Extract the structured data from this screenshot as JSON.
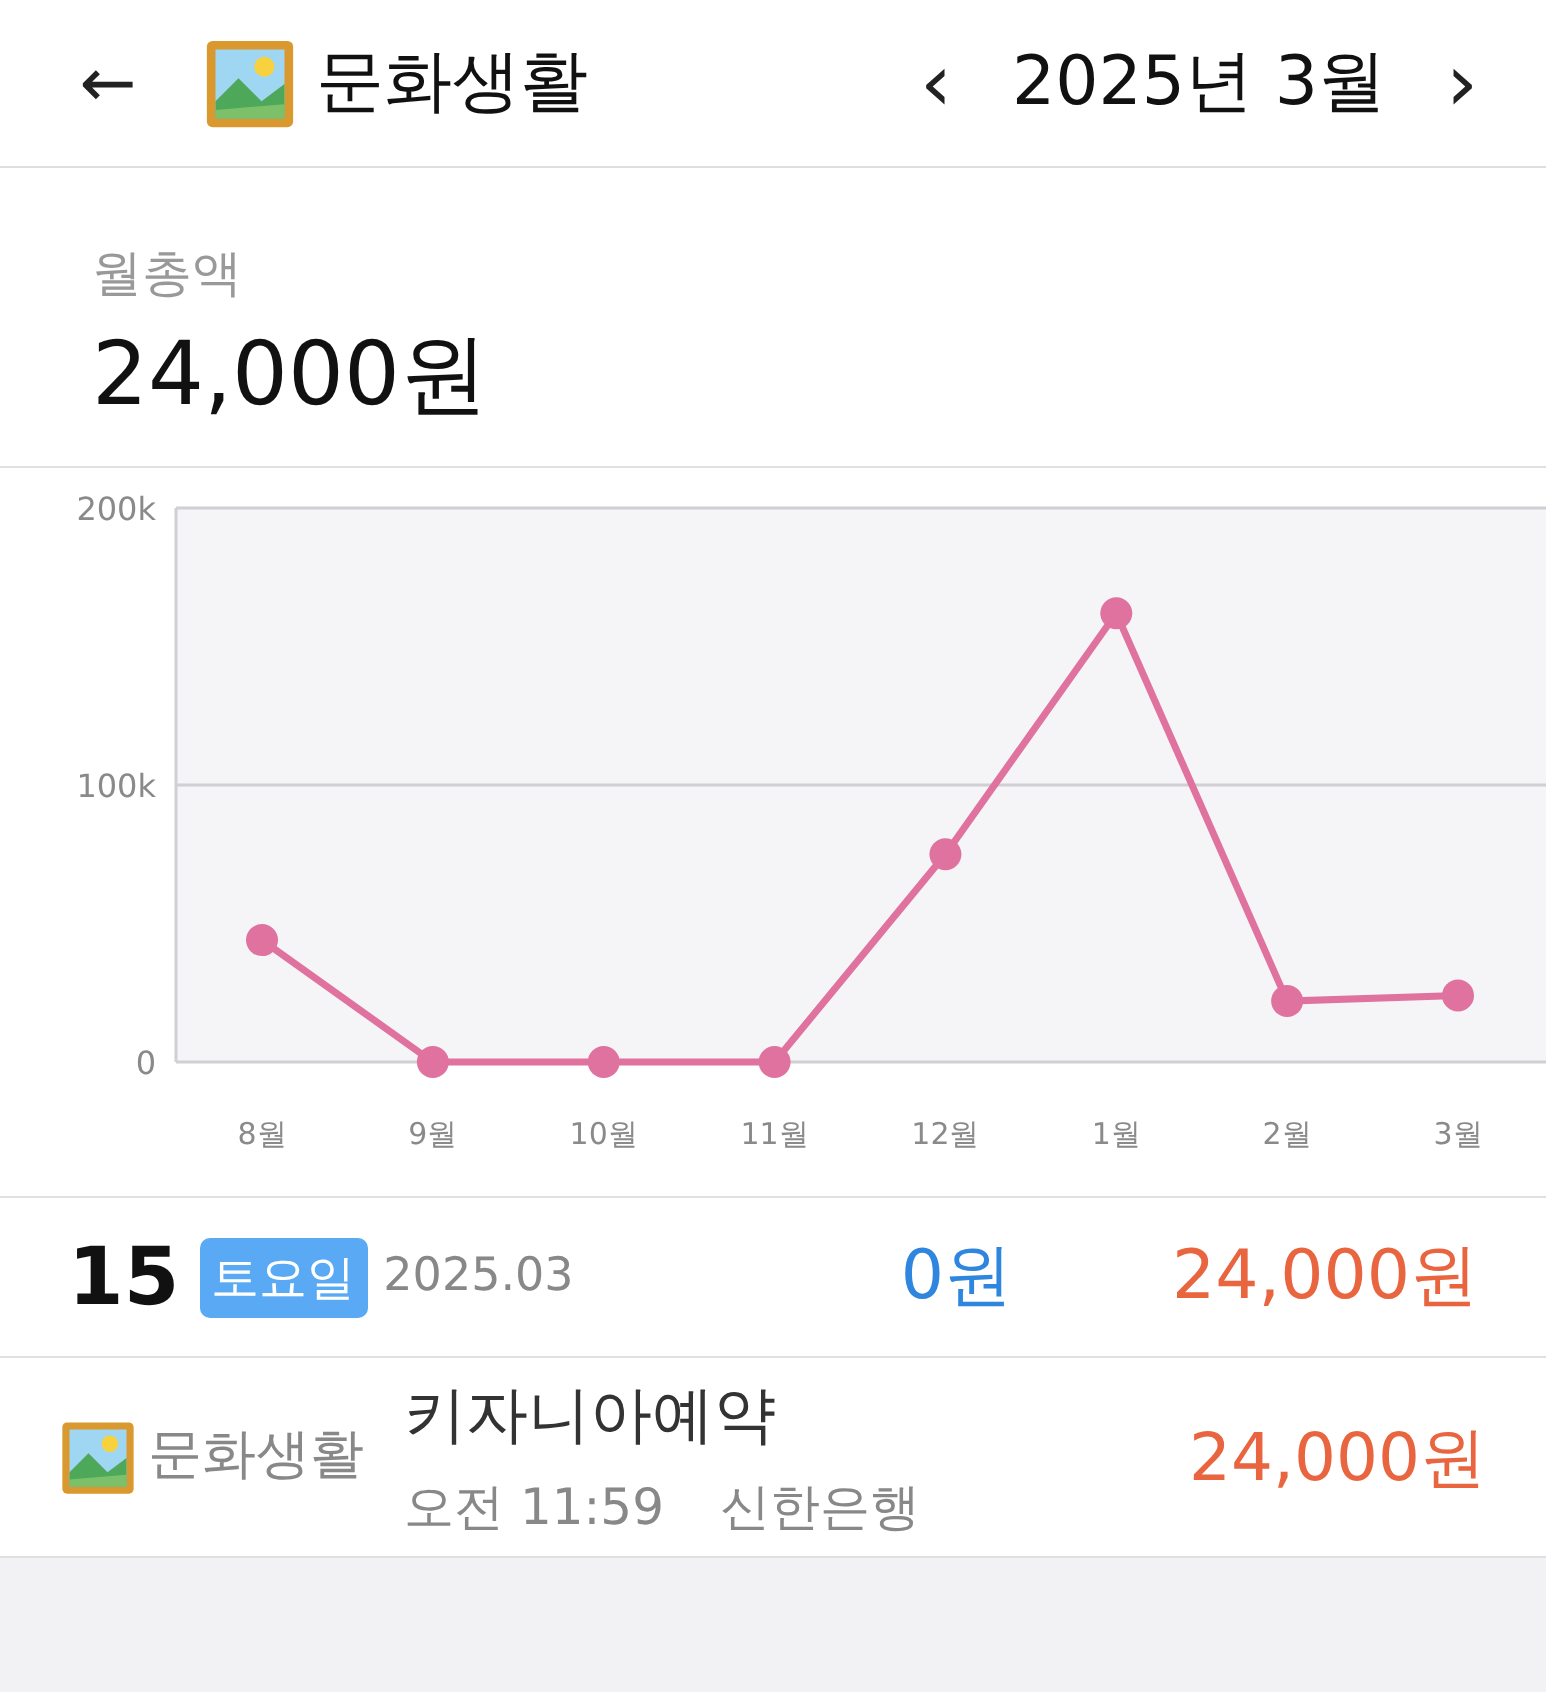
{
  "header": {
    "back": "←",
    "title": "문화생활",
    "prev": "‹",
    "month": "2025년 3월",
    "next": "›"
  },
  "summary": {
    "label": "월총액",
    "amount": "24,000원"
  },
  "chart": {
    "chart_data": {
      "type": "line",
      "categories": [
        "8월",
        "9월",
        "10월",
        "11월",
        "12월",
        "1월",
        "2월",
        "3월"
      ],
      "series": [
        {
          "color": "#e0729f",
          "marker": "circle",
          "values": [
            44000,
            0,
            0,
            0,
            75000,
            162000,
            22000,
            24000
          ]
        }
      ],
      "ylim": [
        0,
        200000
      ],
      "yticks": [
        {
          "value": 0,
          "label": "0"
        },
        {
          "value": 100000,
          "label": "100k"
        },
        {
          "value": 200000,
          "label": "200k"
        }
      ]
    }
  },
  "day": {
    "date": "15",
    "weekday": "토요일",
    "month": "2025.03",
    "income": "0원",
    "expense": "24,000원"
  },
  "transactions": [
    {
      "category": "문화생활",
      "title": "키자니아예약",
      "time": "오전 11:59",
      "account": "신한은행",
      "amount": "24,000원"
    }
  ]
}
